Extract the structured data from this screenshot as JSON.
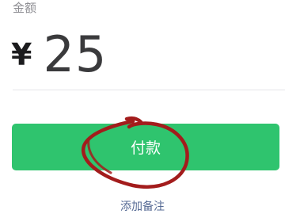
{
  "amount": {
    "label": "金额",
    "currency_symbol": "¥",
    "value": "25"
  },
  "pay_button": {
    "label": "付款",
    "color": "#2fc46e"
  },
  "remark_link": {
    "label": "添加备注",
    "color": "#576b95"
  },
  "annotation": {
    "shape": "hand-drawn-circle",
    "color": "#a31c1c"
  }
}
